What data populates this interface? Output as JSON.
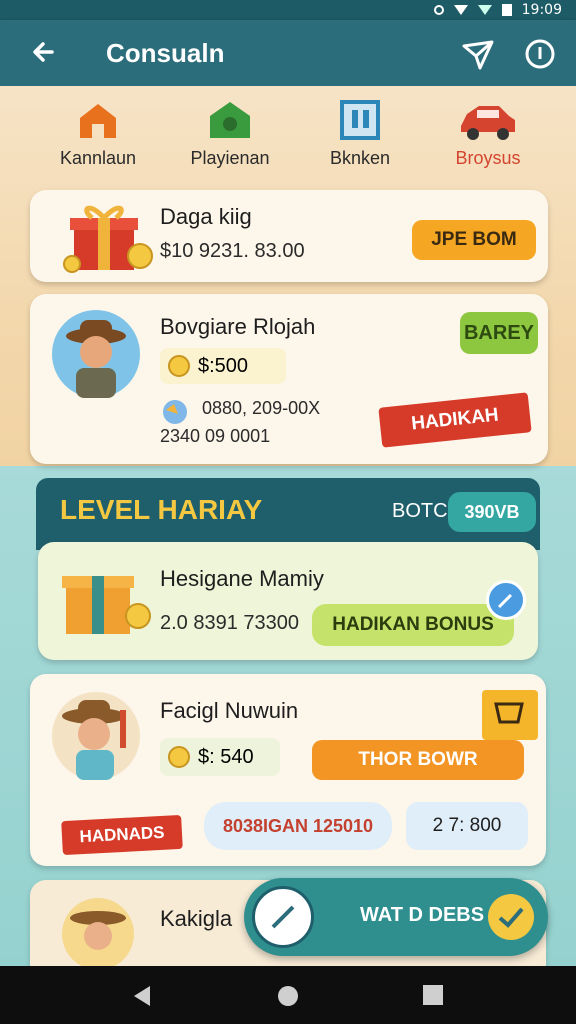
{
  "status": {
    "time": "19:09"
  },
  "appbar": {
    "title": "Consualn",
    "icons": [
      "back-arrow-icon",
      "send-icon",
      "info-icon"
    ]
  },
  "categories": [
    {
      "label": "Kannlaun",
      "icon": "house-icon",
      "color": "#e8711e"
    },
    {
      "label": "Playienan",
      "icon": "home-green-icon",
      "color": "#3a9a3e"
    },
    {
      "label": "Bknken",
      "icon": "building-icon",
      "color": "#2c86b8"
    },
    {
      "label": "Broysus",
      "icon": "car-icon",
      "color": "#d4442e",
      "active": true
    }
  ],
  "card1": {
    "title": "Daga kiig",
    "amount": "$10 9231. 83.00",
    "button": "JPE BOM"
  },
  "card2": {
    "title": "Bovgiare Rlojah",
    "coin_amount": "$:500",
    "stat_line1": "0880, 209-00X",
    "stat_line2": "2340  09 0001",
    "speech_badge": "BAREY",
    "ribbon": "HADIKAH"
  },
  "level": {
    "title": "LEVEL HARIAY",
    "label": "BOTC",
    "pill": "390VB"
  },
  "card3": {
    "title": "Hesigane Mamiy",
    "amount": "2.0  8391 73300",
    "button": "HADIKAN BONUS"
  },
  "card4": {
    "title": "Facigl Nuwuin",
    "coin_amount": "$: 540",
    "button": "THOR  BOWR",
    "ribbon": "HADNADS",
    "chip1": "8038IGAN 125010",
    "chip2": "2 7: 800"
  },
  "card5": {
    "title": "Kakigla"
  },
  "fab": {
    "label": "WAT D DEBS"
  },
  "colors": {
    "appbar": "#2b6d7a",
    "accent_orange": "#f5a623",
    "accent_green": "#c5e36b",
    "accent_red": "#d4442e",
    "teal": "#2f8f8f"
  }
}
